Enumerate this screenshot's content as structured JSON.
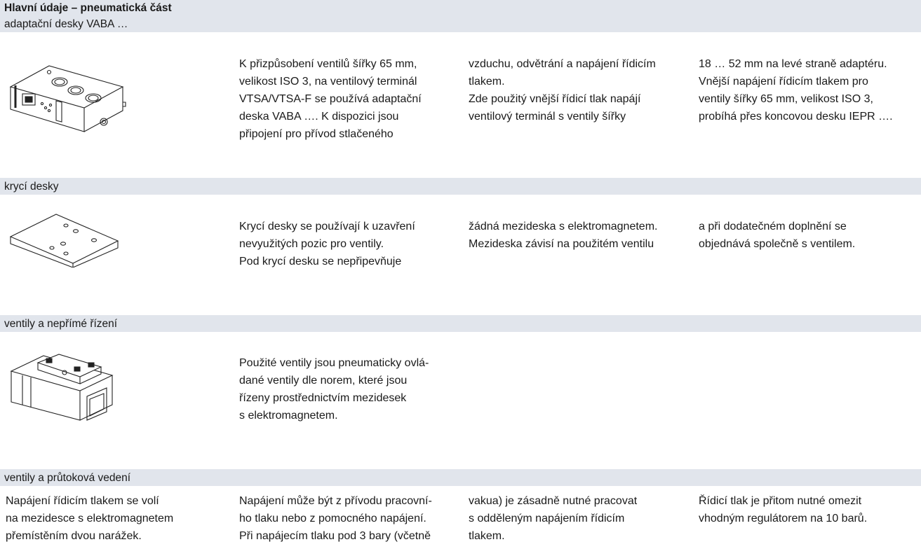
{
  "title": "Hlavní údaje – pneumatická část",
  "sections": [
    {
      "heading": "adaptační desky VABA …",
      "image": "adapter-plate-vaba-drawing",
      "columns": [
        [
          "K přizpůsobení ventilů šířky 65 mm,",
          "velikost ISO 3, na ventilový terminál",
          "VTSA/VTSA-F se používá adaptační",
          "deska VABA …. K dispozici jsou",
          "připojení pro přívod stlačeného"
        ],
        [
          "vzduchu, odvětrání a napájení řídicím",
          "tlakem.",
          "Zde použitý vnější řídicí tlak napájí",
          "ventilový terminál s ventily šířky"
        ],
        [
          "18 … 52 mm na levé straně adaptéru.",
          "Vnější napájení řídicím tlakem pro",
          "ventily šířky 65 mm, velikost ISO 3,",
          "probíhá přes koncovou desku IEPR …."
        ]
      ]
    },
    {
      "heading": "krycí desky",
      "image": "cover-plate-drawing",
      "columns": [
        [
          "Krycí desky se používají k uzavření",
          "nevyužitých pozic pro ventily.",
          "Pod krycí desku se nepřipevňuje"
        ],
        [
          "žádná mezideska s elektromagnetem.",
          "Mezideska závisí na použitém ventilu"
        ],
        [
          "a při dodatečném doplnění se",
          "objednává společně s ventilem."
        ]
      ]
    },
    {
      "heading": "ventily a nepřímé řízení",
      "image": "valve-drawing",
      "columns": [
        [
          "Použité ventily jsou pneumaticky ovlá-",
          "dané ventily dle norem, které jsou",
          "řízeny prostřednictvím mezidesek",
          "s elektromagnetem."
        ]
      ]
    },
    {
      "heading": "ventily a průtoková vedení",
      "columns": [
        [
          "Napájení řídicím tlakem se volí",
          "na mezidesce s elektromagnetem",
          "přemístěním dvou narážek."
        ],
        [
          "Napájení může být z přívodu pracovní-",
          "ho tlaku nebo z pomocného napájení.",
          "Při napájecím tlaku pod 3 bary (včetně"
        ],
        [
          "vakua) je zásadně nutné pracovat",
          "s odděleným napájením řídicím",
          "tlakem."
        ],
        [
          "Řídicí tlak je přitom nutné omezit",
          "vhodným regulátorem na 10 barů."
        ]
      ]
    }
  ]
}
